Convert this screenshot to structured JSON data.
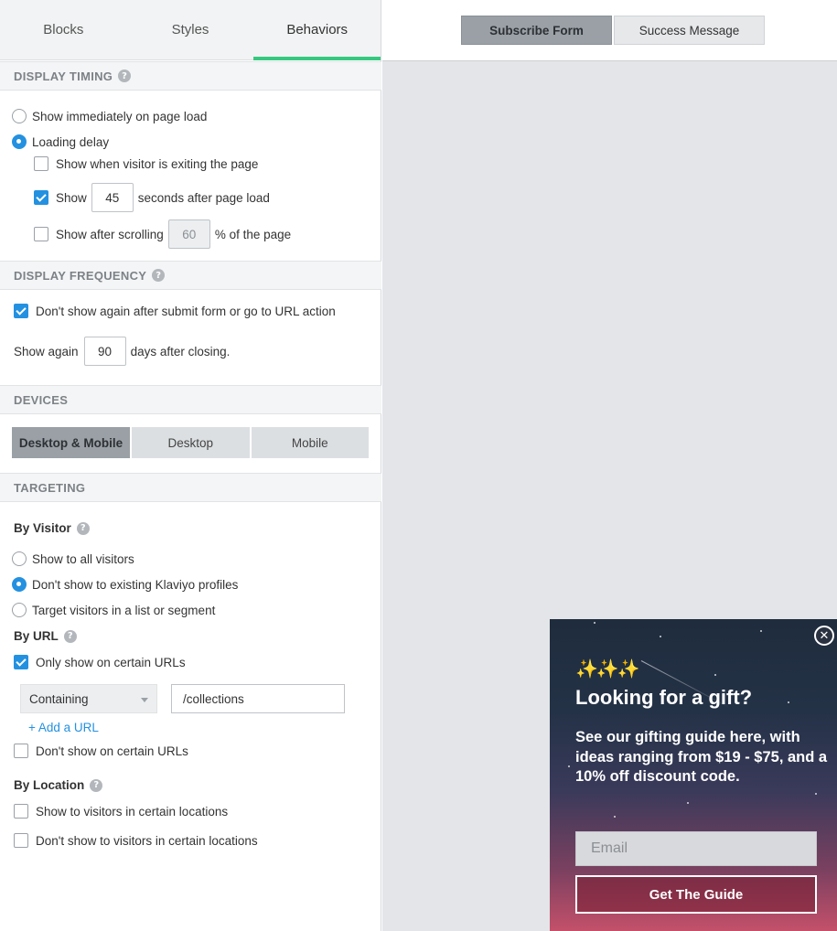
{
  "tabs": [
    "Blocks",
    "Styles",
    "Behaviors"
  ],
  "display_timing": {
    "heading": "DISPLAY TIMING",
    "show_immediately": "Show immediately on page load",
    "loading_delay": "Loading delay",
    "exit_label": "Show when visitor is exiting the page",
    "show_label": "Show",
    "seconds_value": "45",
    "seconds_suffix": "seconds after page load",
    "scroll_label": "Show after scrolling",
    "scroll_value": "60",
    "scroll_suffix": "% of the page"
  },
  "display_frequency": {
    "heading": "DISPLAY FREQUENCY",
    "dont_show_again": "Don't show again after submit form or go to URL action",
    "show_again_label": "Show again",
    "days_value": "90",
    "days_suffix": "days after closing."
  },
  "devices": {
    "heading": "DEVICES",
    "options": [
      "Desktop & Mobile",
      "Desktop",
      "Mobile"
    ]
  },
  "targeting": {
    "heading": "TARGETING",
    "by_visitor": "By Visitor",
    "all_visitors": "Show to all visitors",
    "not_existing": "Don't show to existing Klaviyo profiles",
    "target_list": "Target visitors in a list or segment",
    "by_url": "By URL",
    "only_certain_urls": "Only show on certain URLs",
    "match_type": "Containing",
    "url_value": "/collections",
    "add_url": "+ Add a URL",
    "dont_certain_urls": "Don't show on certain URLs",
    "by_location": "By Location",
    "show_locations": "Show to visitors in certain locations",
    "dont_locations": "Don't show to visitors in certain locations"
  },
  "preview": {
    "tab_subscribe": "Subscribe Form",
    "tab_success": "Success Message",
    "popup": {
      "sparkles": "✨✨✨",
      "title": "Looking for a gift?",
      "body": "See our gifting guide here, with ideas ranging from $19 - $75, and a 10% off discount code.",
      "email_placeholder": "Email",
      "button": "Get The Guide",
      "close": "✕"
    }
  },
  "colors": {
    "accent_green": "#35c97f",
    "accent_blue": "#2491e0"
  }
}
